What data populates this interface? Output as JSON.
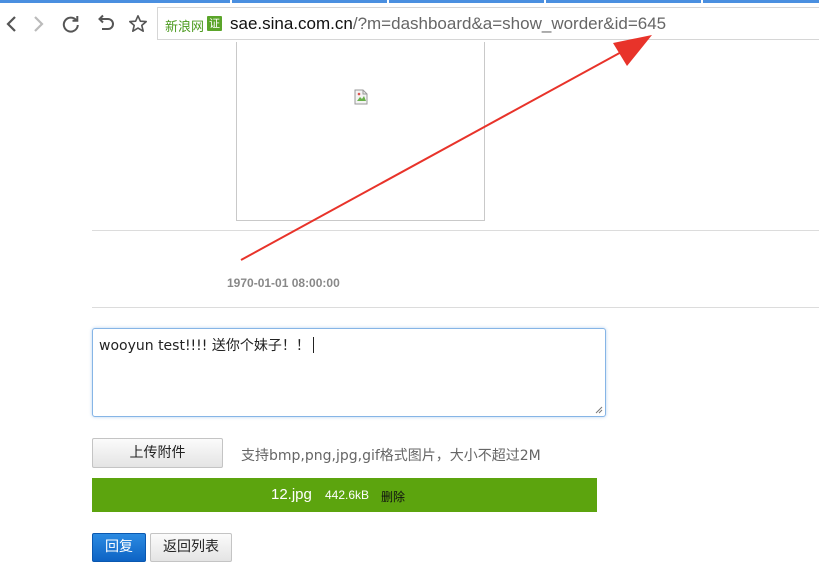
{
  "browser": {
    "site_label": "新浪网",
    "cert_badge": "证",
    "url_host": "sae.sina.com.cn",
    "url_path": "/?m=dashboard&a=show_worder&id=645",
    "accent_color": "#4a8fe0"
  },
  "message": {
    "timestamp": "1970-01-01 08:00:00"
  },
  "reply": {
    "text": "wooyun test!!!!  送你个妹子！！"
  },
  "upload": {
    "button_label": "上传附件",
    "hint": "支持bmp,png,jpg,gif格式图片，大小不超过2M"
  },
  "attachment": {
    "filename": "12.jpg",
    "size": "442.6kB",
    "delete_label": "删除",
    "bar_color": "#5ca40e"
  },
  "actions": {
    "reply_label": "回复",
    "back_label": "返回列表"
  },
  "annotation_color": "#e8332a"
}
